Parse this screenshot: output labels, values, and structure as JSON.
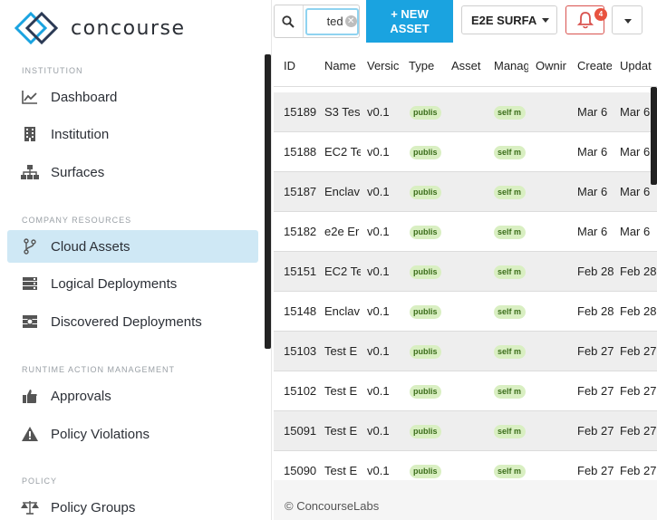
{
  "brand": {
    "name": "concourse",
    "accent": "#1aa3e0"
  },
  "sidebar": {
    "sections": [
      {
        "label": "INSTITUTION"
      },
      {
        "label": "COMPANY RESOURCES"
      },
      {
        "label": "RUNTIME ACTION MANAGEMENT"
      },
      {
        "label": "POLICY"
      }
    ],
    "items": [
      {
        "label": "Dashboard",
        "icon": "chart-line-icon"
      },
      {
        "label": "Institution",
        "icon": "building-icon"
      },
      {
        "label": "Surfaces",
        "icon": "hierarchy-icon"
      },
      {
        "label": "Cloud Assets",
        "icon": "git-branch-icon",
        "active": true
      },
      {
        "label": "Logical Deployments",
        "icon": "server-icon"
      },
      {
        "label": "Discovered Deployments",
        "icon": "search-server-icon"
      },
      {
        "label": "Approvals",
        "icon": "thumbs-up-icon"
      },
      {
        "label": "Policy Violations",
        "icon": "warning-icon"
      },
      {
        "label": "Policy Groups",
        "icon": "scales-icon"
      }
    ]
  },
  "topbar": {
    "search_value": "ted",
    "new_asset_line1": "+ NEW",
    "new_asset_line2": "ASSET",
    "surface_label": "E2E SURFA",
    "notification_count": "4"
  },
  "table": {
    "columns": [
      "ID",
      "Name",
      "Versic",
      "Type",
      "Asset",
      "Manag",
      "Ownir",
      "Create",
      "Updat"
    ],
    "rows": [
      {
        "id": "15189",
        "name": "S3 Tes",
        "version": "v0.1",
        "type": "publis",
        "manage": "self m",
        "created": "Mar 6",
        "updated": "Mar 6"
      },
      {
        "id": "15188",
        "name": "EC2 Te",
        "version": "v0.1",
        "type": "publis",
        "manage": "self m",
        "created": "Mar 6",
        "updated": "Mar 6"
      },
      {
        "id": "15187",
        "name": "Enclav",
        "version": "v0.1",
        "type": "publis",
        "manage": "self m",
        "created": "Mar 6",
        "updated": "Mar 6"
      },
      {
        "id": "15182",
        "name": "e2e Er",
        "version": "v0.1",
        "type": "publis",
        "manage": "self m",
        "created": "Mar 6",
        "updated": "Mar 6"
      },
      {
        "id": "15151",
        "name": "EC2 Te",
        "version": "v0.1",
        "type": "publis",
        "manage": "self m",
        "created": "Feb 28",
        "updated": "Feb 28"
      },
      {
        "id": "15148",
        "name": "Enclav",
        "version": "v0.1",
        "type": "publis",
        "manage": "self m",
        "created": "Feb 28",
        "updated": "Feb 28"
      },
      {
        "id": "15103",
        "name": "Test E",
        "version": "v0.1",
        "type": "publis",
        "manage": "self m",
        "created": "Feb 27",
        "updated": "Feb 27"
      },
      {
        "id": "15102",
        "name": "Test E",
        "version": "v0.1",
        "type": "publis",
        "manage": "self m",
        "created": "Feb 27",
        "updated": "Feb 27"
      },
      {
        "id": "15091",
        "name": "Test E",
        "version": "v0.1",
        "type": "publis",
        "manage": "self m",
        "created": "Feb 27",
        "updated": "Feb 27"
      },
      {
        "id": "15090",
        "name": "Test E",
        "version": "v0.1",
        "type": "publis",
        "manage": "self m",
        "created": "Feb 27",
        "updated": "Feb 27"
      }
    ]
  },
  "footer": {
    "text": "© ConcourseLabs"
  }
}
